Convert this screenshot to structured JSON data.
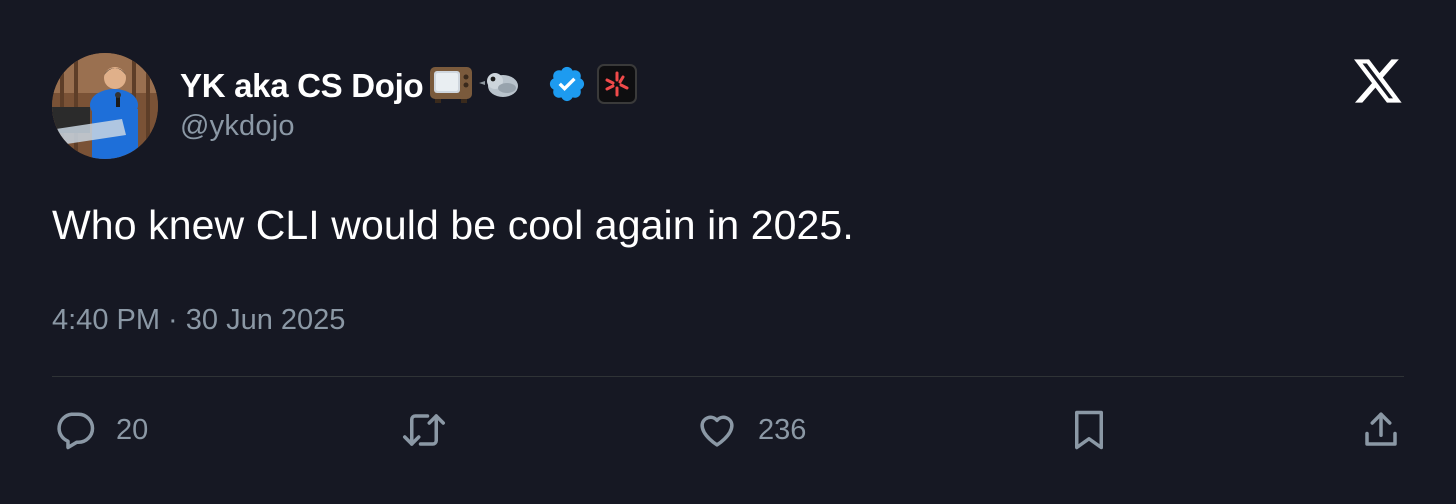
{
  "author": {
    "display_name": "YK aka CS Dojo",
    "handle": "@ykdojo",
    "name_emojis": [
      "television-emoji",
      "bird-emoji"
    ],
    "verified": true,
    "affiliate_badge": "sparkle-logo-icon"
  },
  "tweet": {
    "text": "Who knew CLI would be cool again in 2025.",
    "timestamp": "4:40 PM · 30 Jun 2025"
  },
  "actions": {
    "reply_count": "20",
    "like_count": "236"
  },
  "colors": {
    "background": "#161823",
    "text_primary": "#ffffff",
    "text_secondary": "#8b98a5",
    "verified_blue": "#1d9bf0",
    "divider": "#2f3336",
    "affil_accent": "#f04a4a"
  },
  "icons": {
    "platform": "x-logo-icon",
    "reply": "reply-icon",
    "retweet": "retweet-icon",
    "like": "heart-icon",
    "bookmark": "bookmark-icon",
    "share": "share-icon"
  }
}
